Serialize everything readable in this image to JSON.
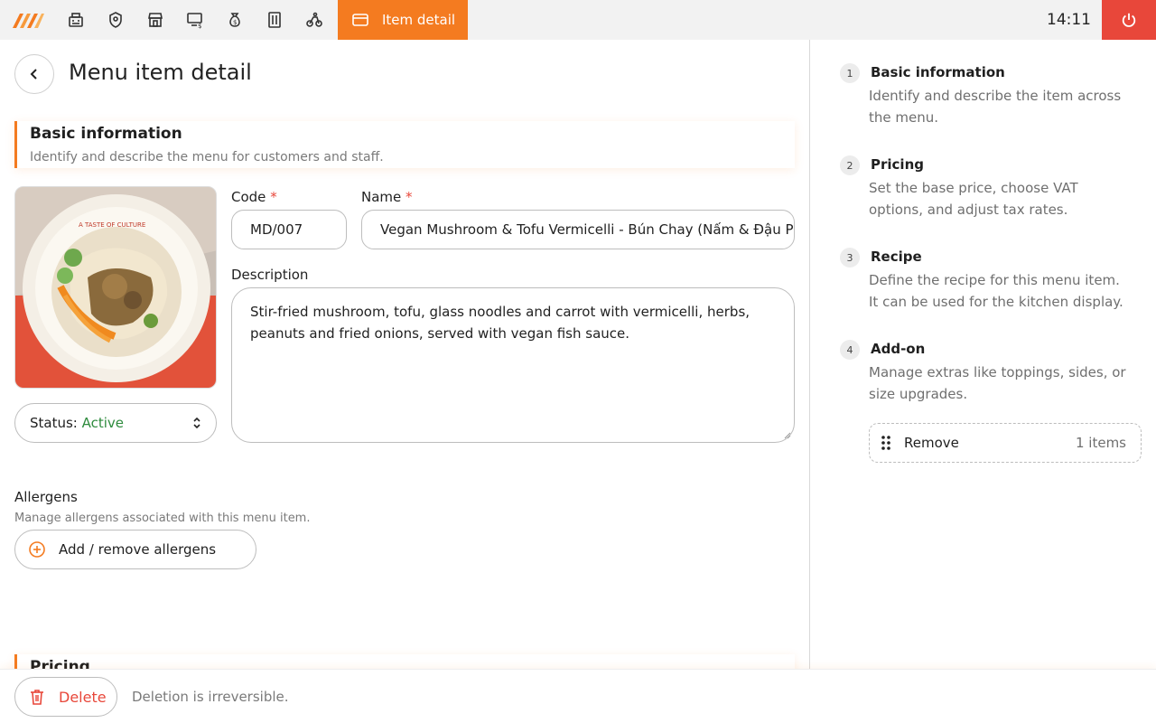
{
  "topbar": {
    "nav_icons": [
      "register-icon",
      "badge-icon",
      "store-icon",
      "terminal-icon",
      "money-bag-icon",
      "menu-icon",
      "delivery-icon"
    ],
    "active_tab_label": "Item detail",
    "clock": "14:11",
    "accent_color": "#f47b20",
    "power_color": "#e8473a"
  },
  "page": {
    "title": "Menu item detail"
  },
  "basic_info": {
    "title": "Basic information",
    "subtitle": "Identify and describe the menu for customers and staff.",
    "code_label": "Code",
    "code_value": "MD/007",
    "name_label": "Name",
    "name_value": "Vegan Mushroom & Tofu Vermicelli - Bún Chay (Nấm & Đậu Phụ)",
    "required_mark": "*",
    "description_label": "Description",
    "description_value": "Stir-fried mushroom, tofu, glass noodles and carrot with vermicelli, herbs, peanuts and fried onions, served with vegan fish sauce.",
    "status_label": "Status:",
    "status_value": "Active",
    "photo_caption": "A TASTE OF CULTURE"
  },
  "allergens": {
    "title": "Allergens",
    "subtitle": "Manage allergens associated with this menu item.",
    "button_label": "Add / remove allergens"
  },
  "pricing_partial_title": "Pricing",
  "steps": [
    {
      "num": "1",
      "title": "Basic information",
      "desc": "Identify and describe the item across the menu."
    },
    {
      "num": "2",
      "title": "Pricing",
      "desc": "Set the base price, choose VAT options, and adjust tax rates."
    },
    {
      "num": "3",
      "title": "Recipe",
      "desc": "Define the recipe for this menu item. It can be used for the kitchen display."
    },
    {
      "num": "4",
      "title": "Add-on",
      "desc": "Manage extras like toppings, sides, or size upgrades."
    }
  ],
  "addon_chip": {
    "label": "Remove",
    "count": "1 items"
  },
  "footer": {
    "delete_label": "Delete",
    "delete_note": "Deletion is irreversible."
  }
}
